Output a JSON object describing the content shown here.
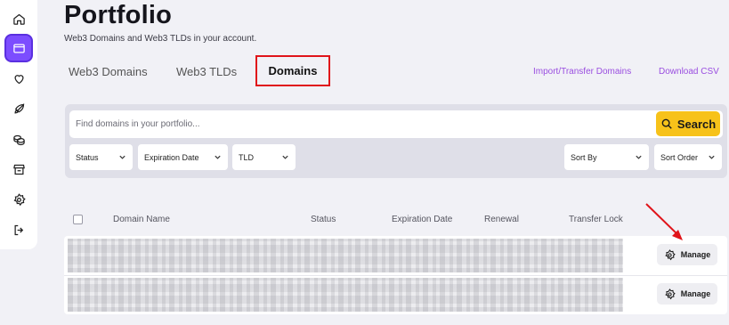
{
  "page": {
    "title": "Portfolio",
    "subtitle": "Web3 Domains and Web3 TLDs in your account."
  },
  "tabs": [
    {
      "label": "Web3 Domains"
    },
    {
      "label": "Web3 TLDs"
    },
    {
      "label": "Domains",
      "active": true
    }
  ],
  "links": {
    "import": "Import/Transfer Domains",
    "download": "Download CSV"
  },
  "search": {
    "placeholder": "Find domains in your portfolio...",
    "button_label": "Search",
    "icon": "search-icon"
  },
  "filters": {
    "status": "Status",
    "expiration": "Expiration Date",
    "tld": "TLD",
    "sort_by": "Sort By",
    "sort_order": "Sort Order"
  },
  "table": {
    "columns": [
      "Domain Name",
      "Status",
      "Expiration Date",
      "Renewal",
      "Transfer Lock"
    ],
    "rows": [
      {
        "action_label": "Manage"
      },
      {
        "action_label": "Manage"
      }
    ]
  },
  "sidebar": {
    "items": [
      {
        "icon": "home-icon"
      },
      {
        "icon": "wallet-icon",
        "active": true
      },
      {
        "icon": "heart-icon"
      },
      {
        "icon": "rocket-icon"
      },
      {
        "icon": "coins-icon"
      },
      {
        "icon": "store-icon"
      },
      {
        "icon": "gear-icon"
      },
      {
        "icon": "logout-icon"
      }
    ]
  },
  "colors": {
    "accent": "#7c4dff",
    "search_button": "#f7c21a",
    "link": "#9a4ee0",
    "highlight_box": "#e0141a",
    "annotation_arrow": "#e0141a"
  }
}
